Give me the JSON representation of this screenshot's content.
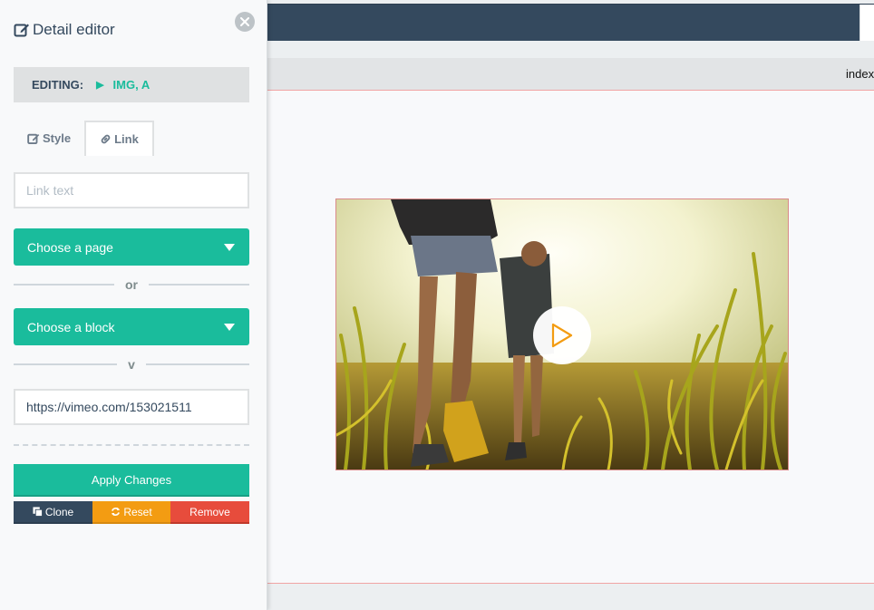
{
  "canvas": {
    "page_name": "index"
  },
  "panel": {
    "title": "Detail editor",
    "title_icon": "pencil-square-icon",
    "close_icon": "close-icon",
    "editing_label": "EDITING:",
    "editing_target": "IMG, A",
    "tabs": [
      {
        "label": "Style",
        "icon": "pencil-square-icon",
        "active": false
      },
      {
        "label": "Link",
        "icon": "link-icon",
        "active": true
      }
    ],
    "link_text_placeholder": "Link text",
    "link_text_value": "",
    "page_select_label": "Choose a page",
    "or_separator": "or",
    "block_select_label": "Choose a block",
    "or_separator_2": "v",
    "url_value": "https://vimeo.com/153021511",
    "apply_label": "Apply Changes",
    "clone_label": "Clone",
    "reset_label": "Reset",
    "remove_label": "Remove"
  },
  "colors": {
    "accent": "#1abc9c",
    "dark": "#34495e",
    "warning": "#f39c12",
    "danger": "#e74c3c",
    "selection_outline": "#f0a4a4"
  }
}
